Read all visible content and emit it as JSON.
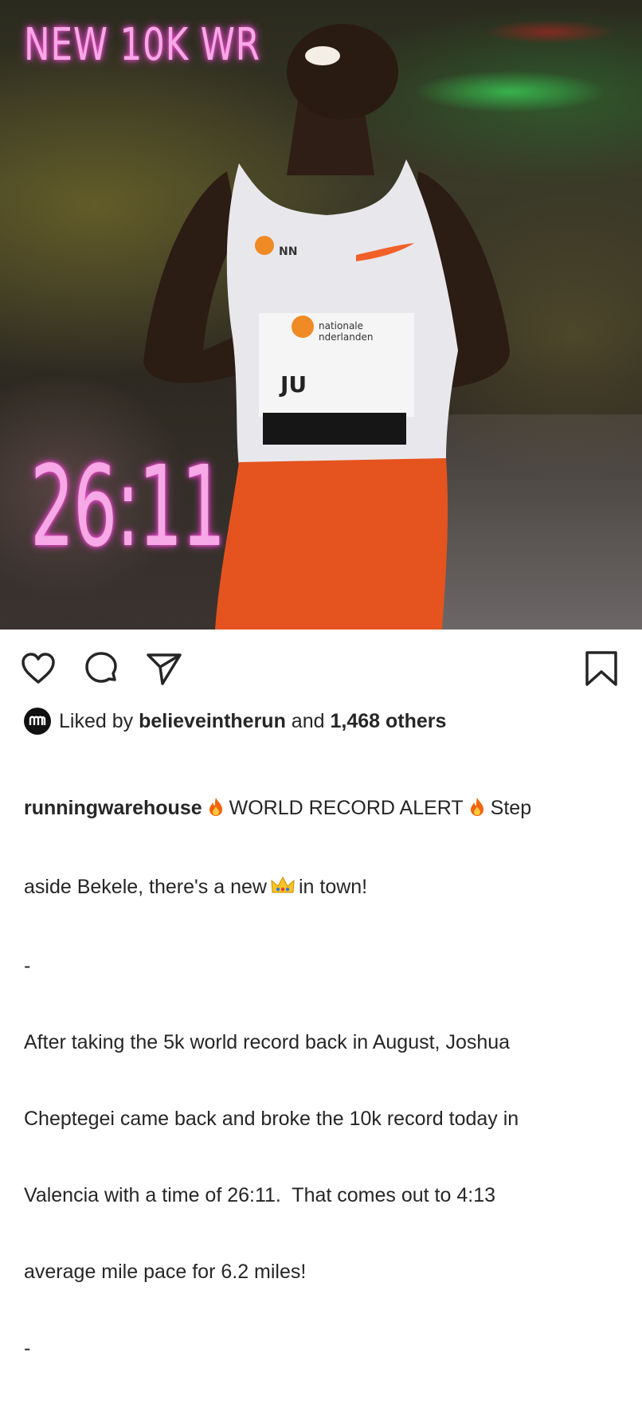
{
  "photo": {
    "headline": "NEW 10K WR",
    "time": "26:11"
  },
  "icons": {
    "like": "heart-icon",
    "comment": "comment-icon",
    "share": "paper-plane-icon",
    "save": "bookmark-icon",
    "liker_avatar": "running-warehouse-logo-icon",
    "fire": "fire-emoji",
    "crown": "crown-emoji"
  },
  "likes": {
    "prefix": "Liked by",
    "user": "believeintherun",
    "middle": "and",
    "count": "1,468 others"
  },
  "caption": {
    "username": "runningwarehouse",
    "part1": "WORLD RECORD ALERT",
    "part2": "Step",
    "line2_start": "aside Bekele, there's a new",
    "line2_end": "in town!",
    "separator1": "-",
    "para_line1": "After taking the 5k world record back in August, Joshua",
    "para_line2": "Cheptegei came back and broke the 10k record today in",
    "para_line3": "Valencia with a time of 26:11.  That comes out to 4:13",
    "para_line4": "average mile pace for 6.2 miles!",
    "separator2": "-"
  },
  "colors": {
    "neon_pink": "#f7a8e6",
    "text": "#262626"
  }
}
